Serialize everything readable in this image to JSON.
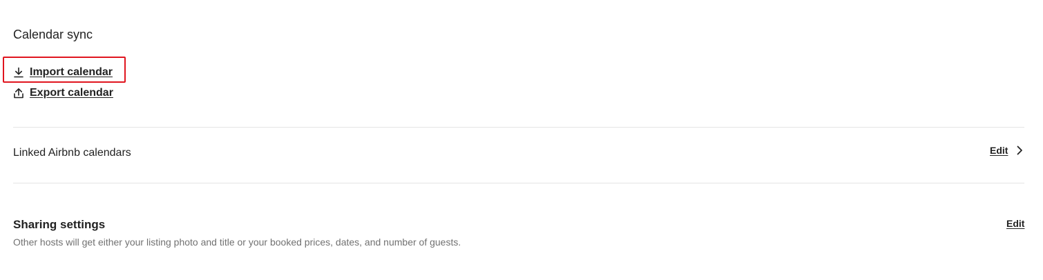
{
  "calendar_sync": {
    "title": "Calendar sync",
    "import_label": "Import calendar",
    "import_icon": "download-icon",
    "export_label": "Export calendar",
    "export_icon": "upload-icon"
  },
  "linked_calendars": {
    "label": "Linked Airbnb calendars",
    "edit_label": "Edit",
    "chevron_icon": "chevron-right-icon"
  },
  "sharing_settings": {
    "title": "Sharing settings",
    "description": "Other hosts will get either your listing photo and title or your booked prices, dates, and number of guests.",
    "edit_label": "Edit"
  },
  "colors": {
    "text": "#222222",
    "muted_text": "#717171",
    "divider": "#e4e4e4",
    "highlight": "#e0141e"
  }
}
